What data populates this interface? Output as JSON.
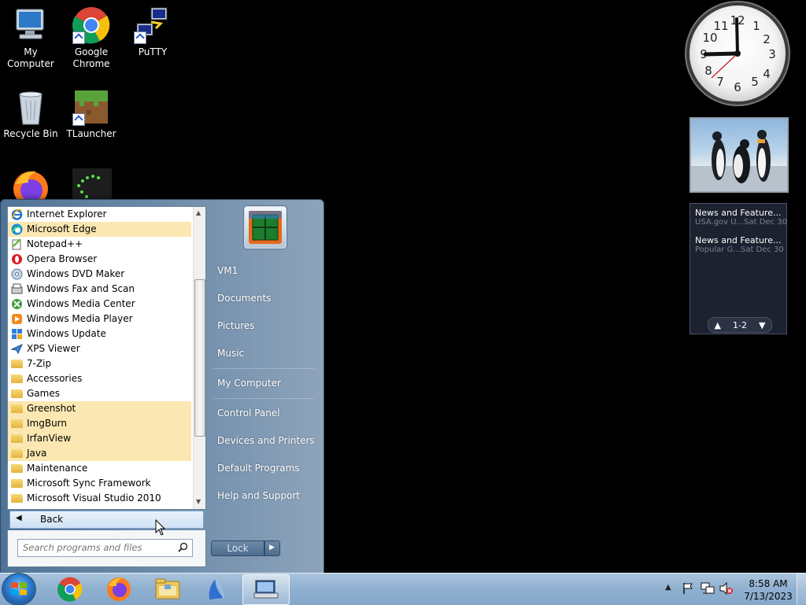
{
  "desktop": {
    "icons": [
      {
        "label": "My Computer",
        "icon": "computer-icon"
      },
      {
        "label": "Google Chrome",
        "icon": "chrome-icon"
      },
      {
        "label": "PuTTY",
        "icon": "putty-icon"
      },
      {
        "label": "Recycle Bin",
        "icon": "recycle-bin-icon"
      },
      {
        "label": "TLauncher",
        "icon": "tlauncher-icon"
      }
    ]
  },
  "gadgets": {
    "clock": {
      "numbers": [
        "12",
        "1",
        "2",
        "3",
        "4",
        "5",
        "6",
        "7",
        "8",
        "9",
        "10",
        "11"
      ]
    },
    "news": {
      "items": [
        {
          "title": "News and Feature...",
          "source": "USA.gov U...",
          "date": "Sat Dec 30"
        },
        {
          "title": "News and Feature...",
          "source": "Popular G...",
          "date": "Sat Dec 30"
        }
      ],
      "pager": "1-2"
    }
  },
  "start_menu": {
    "programs": [
      {
        "label": "Internet Explorer",
        "icon": "internet-explorer-icon",
        "highlight": false
      },
      {
        "label": "Microsoft Edge",
        "icon": "edge-icon",
        "highlight": true
      },
      {
        "label": "Notepad++",
        "icon": "notepadpp-icon",
        "highlight": false
      },
      {
        "label": "Opera Browser",
        "icon": "opera-icon",
        "highlight": false
      },
      {
        "label": "Windows DVD Maker",
        "icon": "dvd-maker-icon",
        "highlight": false
      },
      {
        "label": "Windows Fax and Scan",
        "icon": "fax-scan-icon",
        "highlight": false
      },
      {
        "label": "Windows Media Center",
        "icon": "media-center-icon",
        "highlight": false
      },
      {
        "label": "Windows Media Player",
        "icon": "media-player-icon",
        "highlight": false
      },
      {
        "label": "Windows Update",
        "icon": "windows-update-icon",
        "highlight": false
      },
      {
        "label": "XPS Viewer",
        "icon": "xps-viewer-icon",
        "highlight": false
      },
      {
        "label": "7-Zip",
        "icon": "folder-icon",
        "highlight": false
      },
      {
        "label": "Accessories",
        "icon": "folder-icon",
        "highlight": false
      },
      {
        "label": "Games",
        "icon": "folder-icon",
        "highlight": false
      },
      {
        "label": "Greenshot",
        "icon": "folder-icon",
        "highlight": true
      },
      {
        "label": "ImgBurn",
        "icon": "folder-icon",
        "highlight": true
      },
      {
        "label": "IrfanView",
        "icon": "folder-icon",
        "highlight": true
      },
      {
        "label": "Java",
        "icon": "folder-icon",
        "highlight": true
      },
      {
        "label": "Maintenance",
        "icon": "folder-icon",
        "highlight": false
      },
      {
        "label": "Microsoft Sync Framework",
        "icon": "folder-icon",
        "highlight": false
      },
      {
        "label": "Microsoft Visual Studio 2010",
        "icon": "folder-icon",
        "highlight": false
      }
    ],
    "back_label": "Back",
    "search_placeholder": "Search programs and files",
    "right_links": [
      "VM1",
      "Documents",
      "Pictures",
      "Music",
      "My Computer",
      "Control Panel",
      "Devices and Printers",
      "Default Programs",
      "Help and Support"
    ],
    "lock_label": "Lock"
  },
  "taskbar": {
    "pinned": [
      "chrome-icon",
      "firefox-icon",
      "explorer-folder-icon",
      "app-icon",
      "keyboard-icon"
    ],
    "time": "8:58 AM",
    "date": "7/13/2023"
  },
  "colors": {
    "highlight": "#fbe7b1",
    "desktop": "#000000"
  }
}
